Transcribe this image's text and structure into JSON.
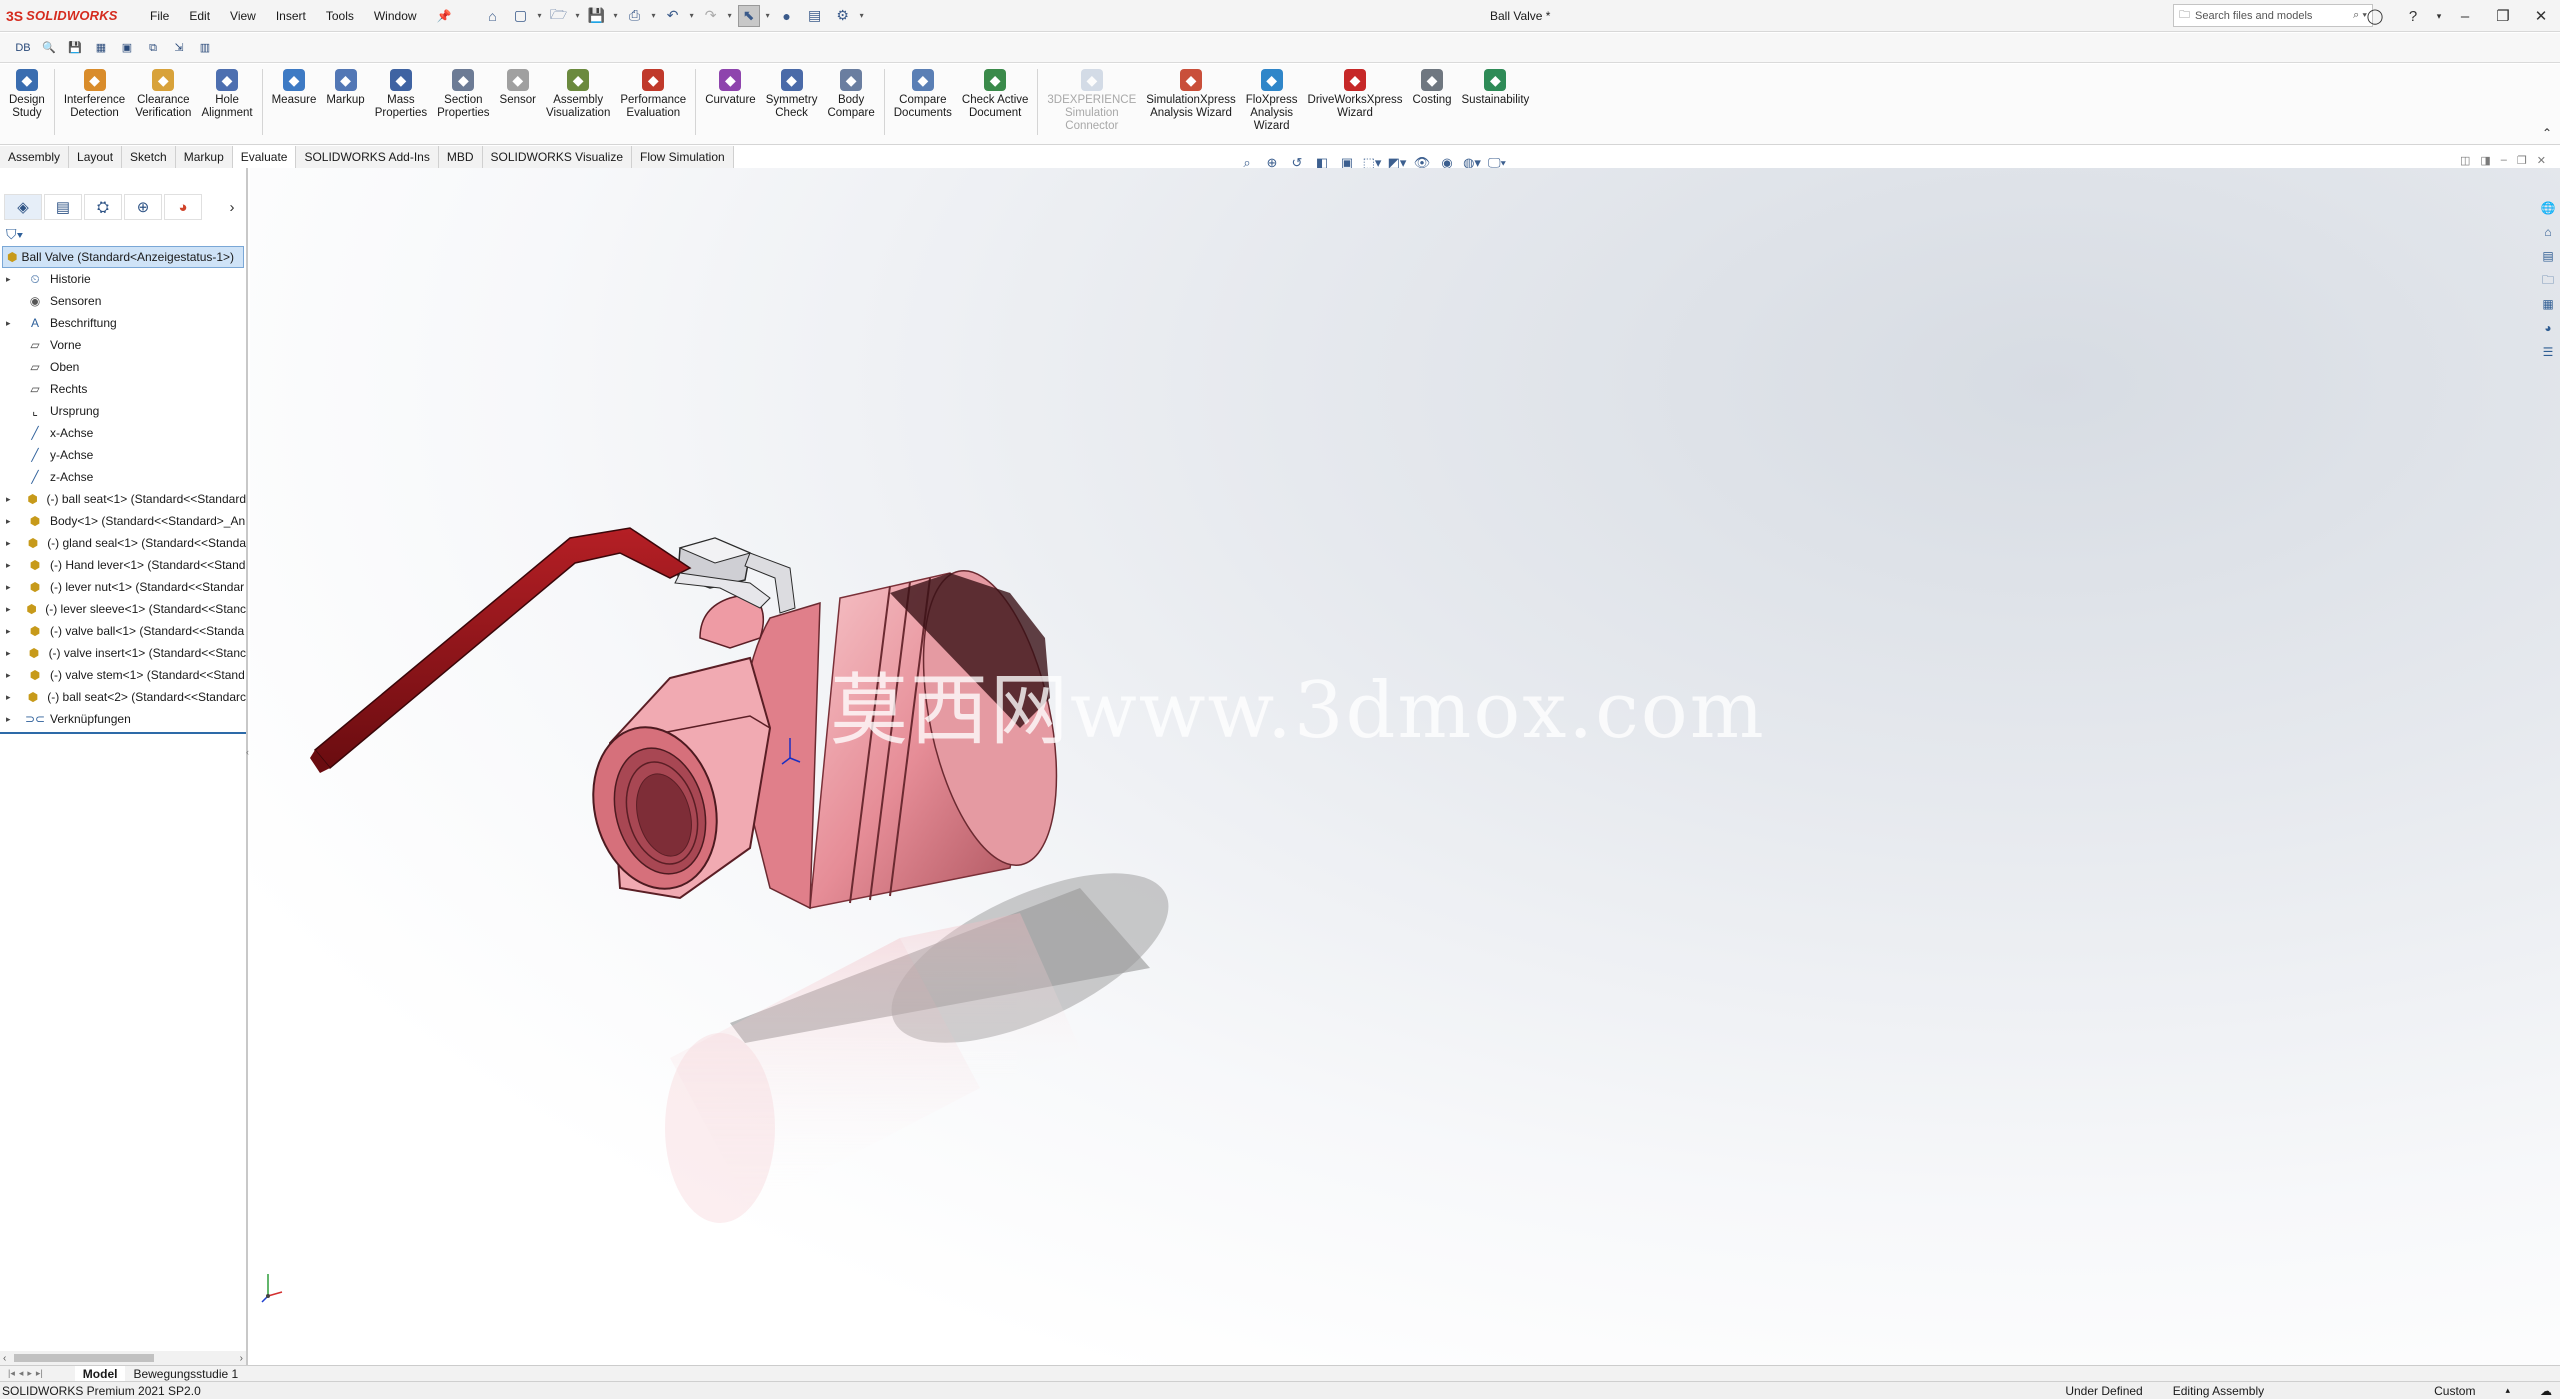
{
  "app": {
    "logo_text": "SOLIDWORKS",
    "logo_mark": "3S",
    "title": "Ball Valve *"
  },
  "menus": [
    "File",
    "Edit",
    "View",
    "Insert",
    "Tools",
    "Window"
  ],
  "search": {
    "placeholder": "Search files and models"
  },
  "command_manager": [
    {
      "label": "Design\nStudy",
      "icon": "design-study-icon",
      "color": "#3a6db0"
    },
    {
      "label": "Interference\nDetection",
      "icon": "interference-icon",
      "color": "#d98c2b"
    },
    {
      "label": "Clearance\nVerification",
      "icon": "clearance-icon",
      "color": "#d8a23a"
    },
    {
      "label": "Hole\nAlignment",
      "icon": "hole-alignment-icon",
      "color": "#4d6fb0"
    },
    {
      "label": "Measure",
      "icon": "measure-icon",
      "color": "#3d7ac4"
    },
    {
      "label": "Markup",
      "icon": "markup-icon",
      "color": "#5277b5"
    },
    {
      "label": "Mass\nProperties",
      "icon": "mass-properties-icon",
      "color": "#3f63a2"
    },
    {
      "label": "Section\nProperties",
      "icon": "section-properties-icon",
      "color": "#6c7b95"
    },
    {
      "label": "Sensor",
      "icon": "sensor-icon",
      "color": "#a0a0a0"
    },
    {
      "label": "Assembly\nVisualization",
      "icon": "assembly-visualization-icon",
      "color": "#6b8a3e"
    },
    {
      "label": "Performance\nEvaluation",
      "icon": "performance-icon",
      "color": "#c0392b"
    },
    {
      "label": "Curvature",
      "icon": "curvature-icon",
      "color": "#8e44ad"
    },
    {
      "label": "Symmetry\nCheck",
      "icon": "symmetry-icon",
      "color": "#4a6aa8"
    },
    {
      "label": "Body\nCompare",
      "icon": "body-compare-icon",
      "color": "#6a7ea0"
    },
    {
      "label": "Compare\nDocuments",
      "icon": "compare-documents-icon",
      "color": "#5a7fb5"
    },
    {
      "label": "Check Active\nDocument",
      "icon": "check-active-icon",
      "color": "#3a8a4a"
    },
    {
      "label": "3DEXPERIENCE\nSimulation\nConnector",
      "icon": "simulation-connector-icon",
      "color": "#8aa0c0",
      "disabled": true
    },
    {
      "label": "SimulationXpress\nAnalysis Wizard",
      "icon": "simulationxpress-icon",
      "color": "#c94f3a"
    },
    {
      "label": "FloXpress\nAnalysis\nWizard",
      "icon": "floxpress-icon",
      "color": "#2f86c9"
    },
    {
      "label": "DriveWorksXpress\nWizard",
      "icon": "driveworks-icon",
      "color": "#c62828"
    },
    {
      "label": "Costing",
      "icon": "costing-icon",
      "color": "#6f7780"
    },
    {
      "label": "Sustainability",
      "icon": "sustainability-icon",
      "color": "#2e8b57"
    }
  ],
  "tabs": [
    "Assembly",
    "Layout",
    "Sketch",
    "Markup",
    "Evaluate",
    "SOLIDWORKS Add-Ins",
    "MBD",
    "SOLIDWORKS Visualize",
    "Flow Simulation"
  ],
  "active_tab": "Evaluate",
  "tree": {
    "root": "Ball Valve  (Standard<Anzeigestatus-1>)",
    "items": [
      {
        "label": "Historie",
        "icon": "history-folder-icon",
        "expand": true
      },
      {
        "label": "Sensoren",
        "icon": "sensor-folder-icon",
        "expand": false
      },
      {
        "label": "Beschriftung",
        "icon": "annotations-icon",
        "expand": true
      },
      {
        "label": "Vorne",
        "icon": "plane-icon",
        "expand": false
      },
      {
        "label": "Oben",
        "icon": "plane-icon",
        "expand": false
      },
      {
        "label": "Rechts",
        "icon": "plane-icon",
        "expand": false
      },
      {
        "label": "Ursprung",
        "icon": "origin-icon",
        "expand": false
      },
      {
        "label": "x-Achse",
        "icon": "axis-icon",
        "expand": false
      },
      {
        "label": "y-Achse",
        "icon": "axis-icon",
        "expand": false
      },
      {
        "label": "z-Achse",
        "icon": "axis-icon",
        "expand": false
      },
      {
        "label": "(-) ball seat<1> (Standard<<Standard",
        "icon": "part-icon",
        "expand": true
      },
      {
        "label": "Body<1> (Standard<<Standard>_An",
        "icon": "part-icon",
        "expand": true
      },
      {
        "label": "(-) gland seal<1> (Standard<<Standa",
        "icon": "part-icon",
        "expand": true
      },
      {
        "label": "(-) Hand lever<1> (Standard<<Stand",
        "icon": "part-icon",
        "expand": true
      },
      {
        "label": "(-) lever nut<1> (Standard<<Standar",
        "icon": "part-icon",
        "expand": true
      },
      {
        "label": "(-) lever sleeve<1> (Standard<<Stanc",
        "icon": "part-icon",
        "expand": true
      },
      {
        "label": "(-) valve ball<1> (Standard<<Standa",
        "icon": "part-icon",
        "expand": true
      },
      {
        "label": "(-) valve insert<1> (Standard<<Stanc",
        "icon": "part-icon",
        "expand": true
      },
      {
        "label": "(-) valve stem<1> (Standard<<Stand",
        "icon": "part-icon",
        "expand": true
      },
      {
        "label": "(-) ball seat<2> (Standard<<Standarc",
        "icon": "part-icon",
        "expand": true
      },
      {
        "label": "Verknüpfungen",
        "icon": "mates-icon",
        "expand": true
      }
    ]
  },
  "watermark": "莫西网www.3dmox.com",
  "bottom_tabs": [
    "Model",
    "Bewegungsstudie 1"
  ],
  "status": {
    "left": "SOLIDWORKS Premium 2021 SP2.0",
    "under_defined": "Under Defined",
    "editing": "Editing Assembly",
    "units": "Custom"
  },
  "colors": {
    "accent": "#d52b1e",
    "lever": "#8b1418",
    "body": "#e89aa2",
    "selection": "#cfe3f7"
  }
}
